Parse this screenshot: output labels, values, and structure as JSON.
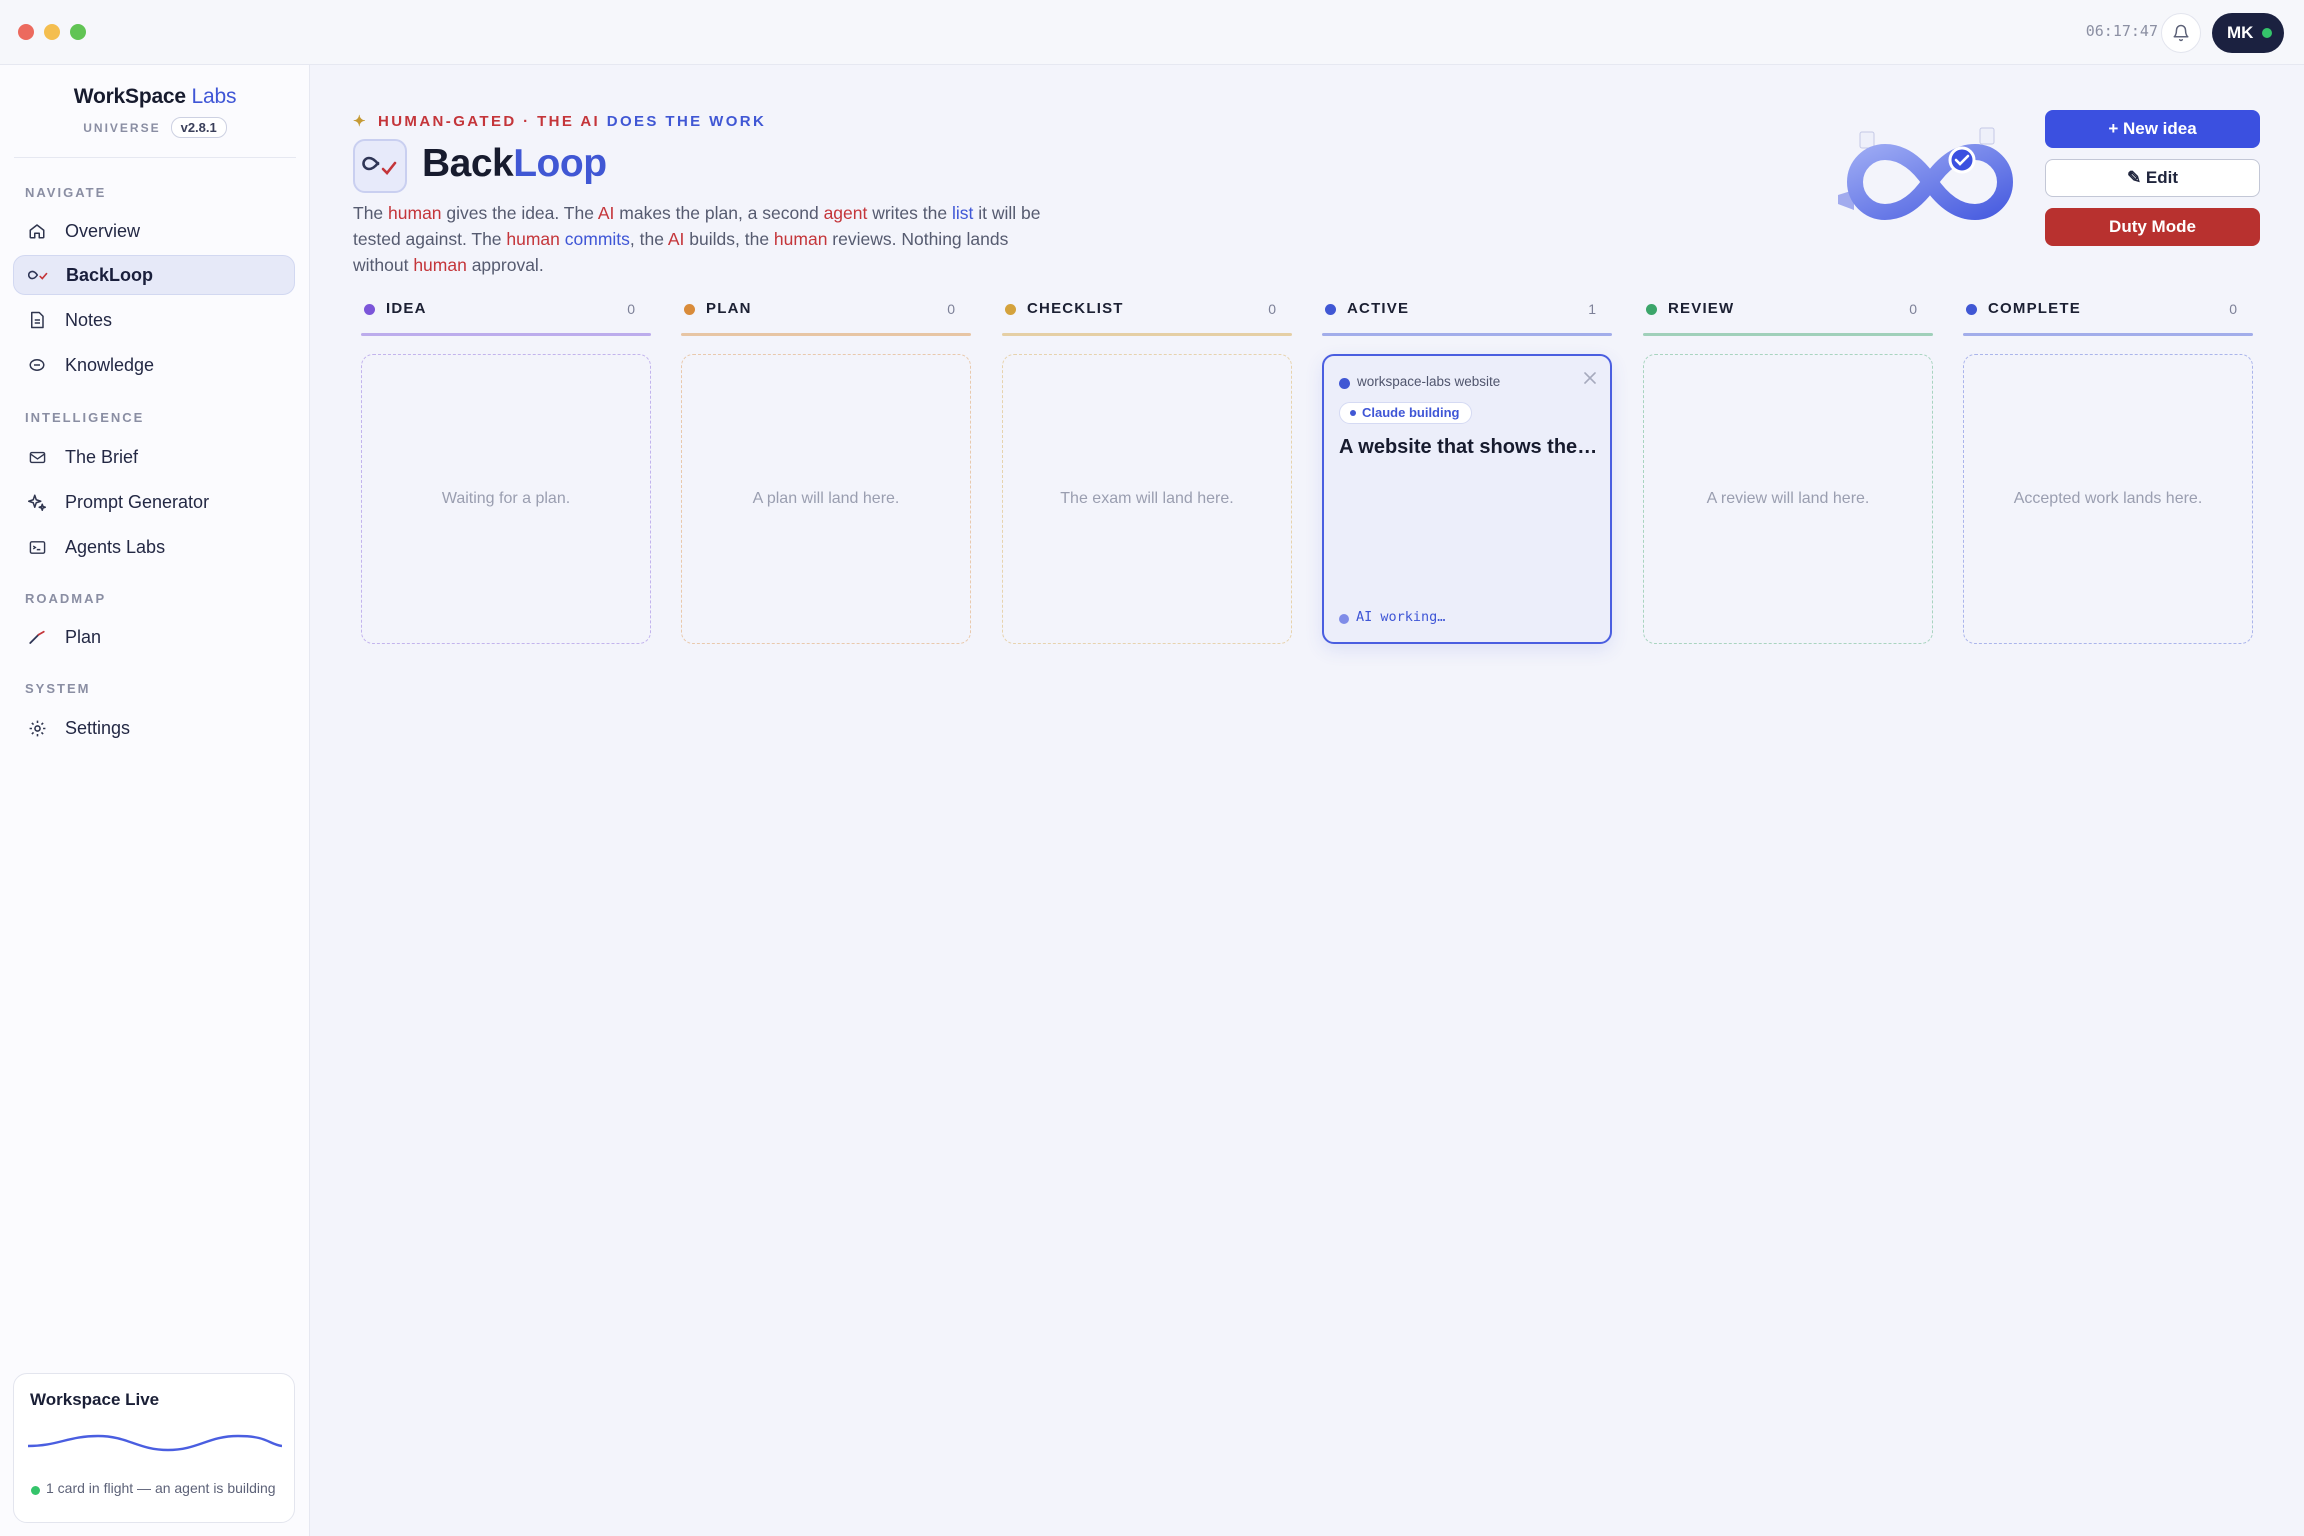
{
  "window": {
    "clock": "06:17:47",
    "user_initials": "MK"
  },
  "brand": {
    "name_primary": "WorkSpace",
    "name_accent": "Labs",
    "subtitle": "UNIVERSE",
    "version": "v2.8.1"
  },
  "sidebar": {
    "sections": {
      "navigate": "NAVIGATE",
      "intelligence": "INTELLIGENCE",
      "roadmap": "ROADMAP",
      "system": "SYSTEM"
    },
    "items": [
      {
        "label": "Overview",
        "icon": "home-icon"
      },
      {
        "label": "BackLoop",
        "icon": "loop-check-icon",
        "active": true
      },
      {
        "label": "Notes",
        "icon": "note-icon"
      },
      {
        "label": "Knowledge",
        "icon": "brain-icon"
      },
      {
        "label": "The Brief",
        "icon": "mail-icon"
      },
      {
        "label": "Prompt Generator",
        "icon": "sparkle-icon"
      },
      {
        "label": "Agents Labs",
        "icon": "terminal-icon"
      },
      {
        "label": "Plan",
        "icon": "trend-line-icon"
      },
      {
        "label": "Settings",
        "icon": "gear-icon"
      }
    ],
    "live": {
      "title": "Workspace Live",
      "status": "1 card in flight — an agent is building"
    }
  },
  "header": {
    "eyebrow_pre": "HUMAN-GATED · THE ",
    "eyebrow_ai": "AI",
    "eyebrow_post": " DOES THE WORK",
    "title_primary": "Back",
    "title_accent": "Loop",
    "desc": [
      "The ",
      "human",
      " gives the idea. The ",
      "AI",
      " makes the plan, a second ",
      "agent",
      " writes the ",
      "list",
      " it will be tested against. The ",
      "human",
      " ",
      "commits",
      ", the ",
      "AI",
      " builds, the ",
      "human",
      " reviews. Nothing lands without ",
      "human",
      " approval."
    ]
  },
  "actions": {
    "new_idea": "+ New idea",
    "edit": "✎ Edit",
    "duty_mode": "Duty Mode"
  },
  "board": {
    "columns": [
      {
        "name": "IDEA",
        "count": "0",
        "empty": "Waiting for a plan.",
        "color": "#7b55d9"
      },
      {
        "name": "PLAN",
        "count": "0",
        "empty": "A plan will land here.",
        "color": "#d98b3a"
      },
      {
        "name": "CHECKLIST",
        "count": "0",
        "empty": "The exam will land here.",
        "color": "#d4a23c"
      },
      {
        "name": "ACTIVE",
        "count": "1",
        "empty": "",
        "color": "#4057d4"
      },
      {
        "name": "REVIEW",
        "count": "0",
        "empty": "A review will land here.",
        "color": "#3ba56a"
      },
      {
        "name": "COMPLETE",
        "count": "0",
        "empty": "Accepted work lands here.",
        "color": "#4057d4"
      }
    ],
    "active_card": {
      "project": "workspace-labs website",
      "badge": "Claude building",
      "title": "A website that shows the …",
      "status": "AI working…"
    }
  }
}
